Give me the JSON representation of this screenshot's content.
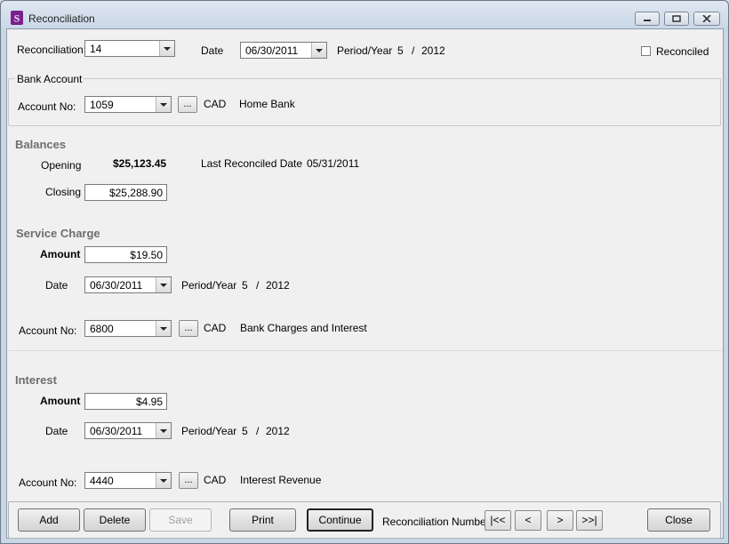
{
  "window": {
    "title": "Reconciliation"
  },
  "header": {
    "reconciliation_label": "Reconciliation:",
    "reconciliation_value": "14",
    "date_label": "Date",
    "date_value": "06/30/2011",
    "period_year_label": "Period/Year",
    "period": "5",
    "slash": "/",
    "year": "2012",
    "reconciled_label": "Reconciled",
    "reconciled_checked": false
  },
  "bank_account": {
    "group_label": "Bank Account",
    "account_no_label": "Account No:",
    "account_no_value": "1059",
    "ellipsis": "...",
    "currency": "CAD",
    "account_name": "Home Bank"
  },
  "balances": {
    "section_label": "Balances",
    "opening_label": "Opening",
    "opening_value": "$25,123.45",
    "last_reconciled_label": "Last Reconciled Date",
    "last_reconciled_value": "05/31/2011",
    "closing_label": "Closing",
    "closing_value": "$25,288.90"
  },
  "service_charge": {
    "section_label": "Service Charge",
    "amount_label": "Amount",
    "amount_value": "$19.50",
    "date_label": "Date",
    "date_value": "06/30/2011",
    "period_year_label": "Period/Year",
    "period": "5",
    "slash": "/",
    "year": "2012",
    "account_no_label": "Account No:",
    "account_no_value": "6800",
    "ellipsis": "...",
    "currency": "CAD",
    "account_name": "Bank Charges and Interest"
  },
  "interest": {
    "section_label": "Interest",
    "amount_label": "Amount",
    "amount_value": "$4.95",
    "date_label": "Date",
    "date_value": "06/30/2011",
    "period_year_label": "Period/Year",
    "period": "5",
    "slash": "/",
    "year": "2012",
    "account_no_label": "Account No:",
    "account_no_value": "4440",
    "ellipsis": "...",
    "currency": "CAD",
    "account_name": "Interest Revenue"
  },
  "footer": {
    "add_label": "Add",
    "delete_label": "Delete",
    "save_label": "Save",
    "print_label": "Print",
    "continue_label": "Continue",
    "reconciliation_number_label": "Reconciliation Number",
    "first_label": "|<<",
    "prev_label": "<",
    "next_label": ">",
    "last_label": ">>|",
    "close_label": "Close"
  }
}
